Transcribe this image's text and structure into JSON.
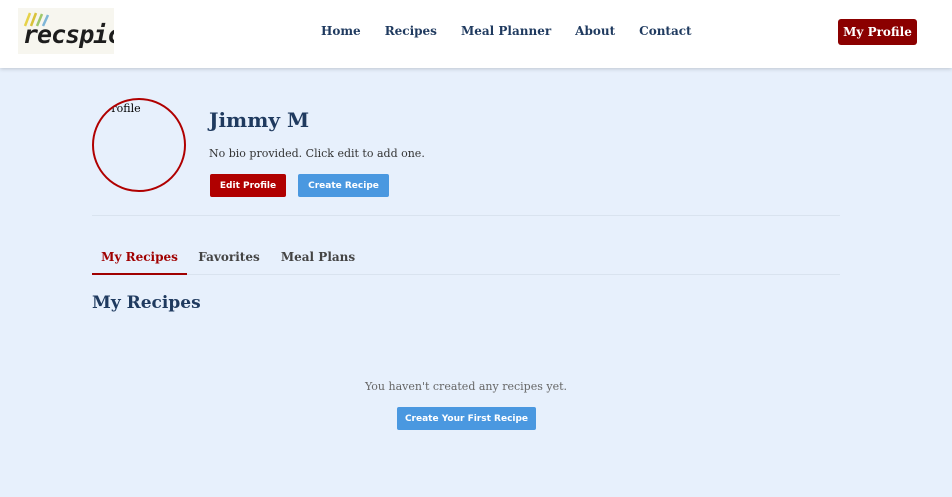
{
  "nav": {
    "logo_text": "recspicy",
    "links": [
      "Home",
      "Recipes",
      "Meal Planner",
      "About",
      "Contact"
    ],
    "profile_button": "My Profile"
  },
  "profile": {
    "avatar_alt": "Profile",
    "name": "Jimmy M",
    "bio": "No bio provided. Click edit to add one.",
    "edit_button": "Edit Profile",
    "create_button": "Create Recipe"
  },
  "tabs": [
    {
      "label": "My Recipes",
      "active": true
    },
    {
      "label": "Favorites",
      "active": false
    },
    {
      "label": "Meal Plans",
      "active": false
    }
  ],
  "main": {
    "section_title": "My Recipes",
    "empty_message": "You haven't created any recipes yet.",
    "first_recipe_button": "Create Your First Recipe"
  },
  "colors": {
    "brand_dark_red": "#8b0000",
    "accent_red": "#b00000",
    "accent_blue": "#4a98e0",
    "heading_navy": "#1f3a5f",
    "page_background": "#e7f0fc"
  }
}
